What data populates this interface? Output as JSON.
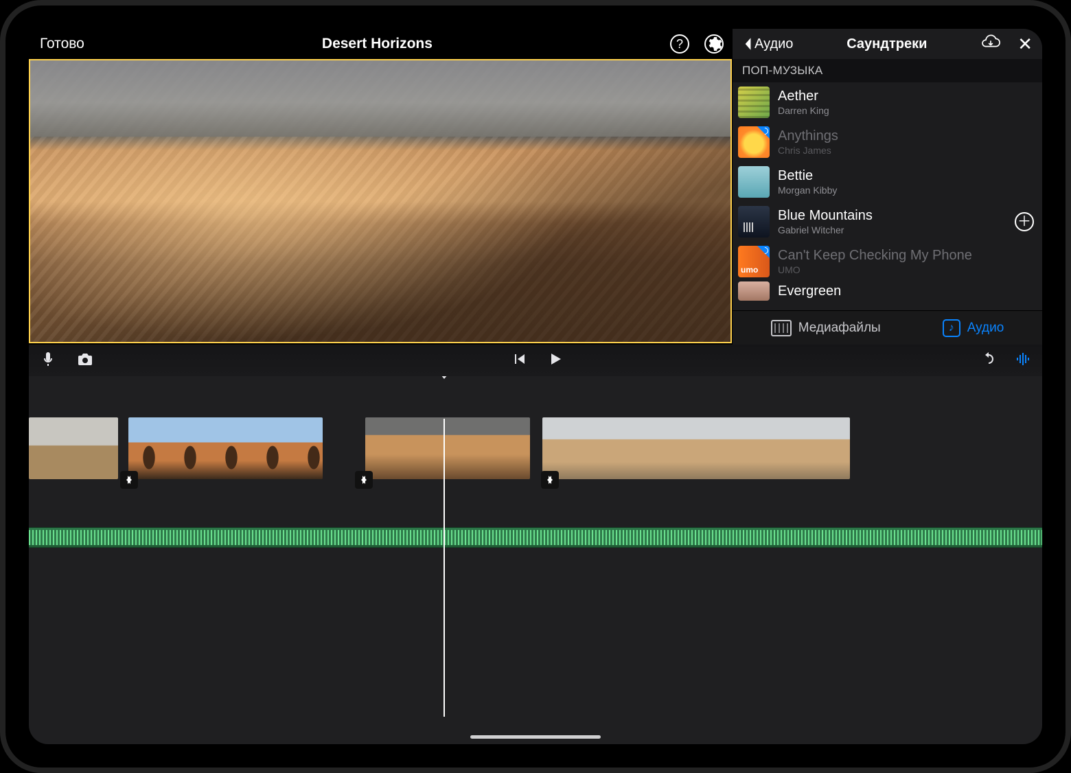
{
  "toolbar": {
    "done": "Готово",
    "title": "Desert Horizons"
  },
  "panel": {
    "back": "Аудио",
    "title": "Саундтреки",
    "category": "ПОП-МУЗЫКА",
    "tracks": [
      {
        "name": "Aether",
        "artist": "Darren King"
      },
      {
        "name": "Anythings",
        "artist": "Chris James"
      },
      {
        "name": "Bettie",
        "artist": "Morgan Kibby"
      },
      {
        "name": "Blue Mountains",
        "artist": "Gabriel Witcher"
      },
      {
        "name": "Can't Keep Checking My Phone",
        "artist": "UMO"
      },
      {
        "name": "Evergreen",
        "artist": ""
      }
    ],
    "tabs": {
      "media": "Медиафайлы",
      "audio": "Аудио"
    }
  }
}
